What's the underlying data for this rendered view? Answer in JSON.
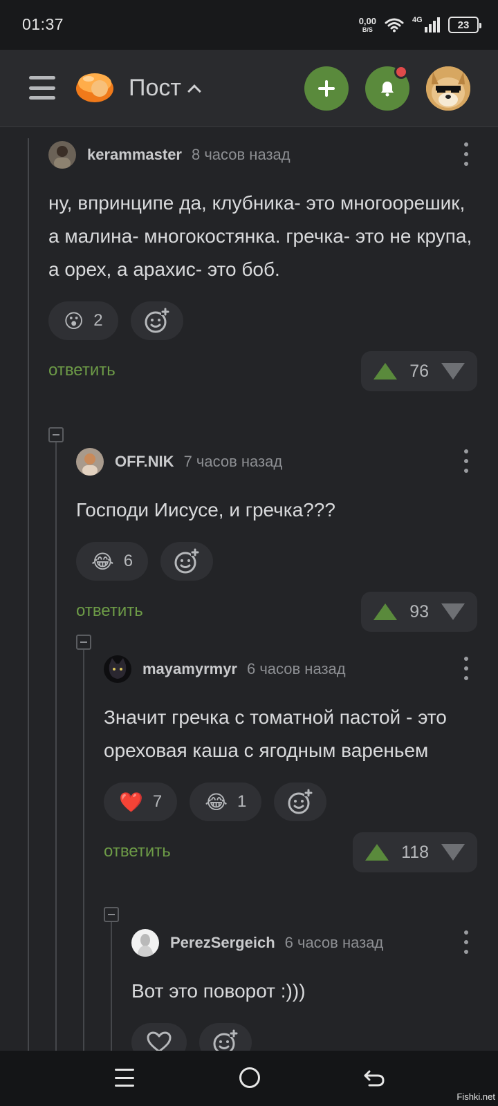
{
  "status_bar": {
    "time": "01:37",
    "net_speed_value": "0,00",
    "net_speed_unit": "B/S",
    "network_type": "4G",
    "battery": "23"
  },
  "header": {
    "title": "Пост",
    "icons": {
      "menu": "hamburger-icon",
      "logo": "pikabu-logo",
      "add": "plus-icon",
      "notifications": "bell-icon",
      "avatar": "doge-avatar"
    },
    "accent_color": "#5a8a3c",
    "notification_color": "#e04a4a"
  },
  "comments": [
    {
      "author": "kerammaster",
      "time": "8 часов назад",
      "text": "ну, впринципе да, клубника- это многоорешик, а малина- многокостянка. гречка- это не крупа, а орех, а арахис- это боб.",
      "reactions": [
        {
          "emoji": "😮",
          "count": "2"
        }
      ],
      "reply_label": "ответить",
      "rating": "76"
    },
    {
      "author": "OFF.NIK",
      "time": "7 часов назад",
      "text": "Господи Иисусе, и гречка???",
      "reactions": [
        {
          "emoji": "😂",
          "count": "6"
        }
      ],
      "reply_label": "ответить",
      "rating": "93"
    },
    {
      "author": "mayamyrmyr",
      "time": "6 часов назад",
      "text": "Значит гречка с томатной пастой - это ореховая каша с ягодным вареньем",
      "reactions": [
        {
          "emoji": "❤️",
          "count": "7"
        },
        {
          "emoji": "😂",
          "count": "1"
        }
      ],
      "reply_label": "ответить",
      "rating": "118"
    },
    {
      "author": "PerezSergeich",
      "time": "6 часов назад",
      "text": "Вот это поворот :)))",
      "reactions": [],
      "reply_label": "",
      "rating": ""
    }
  ],
  "watermark": "Fishki.net"
}
